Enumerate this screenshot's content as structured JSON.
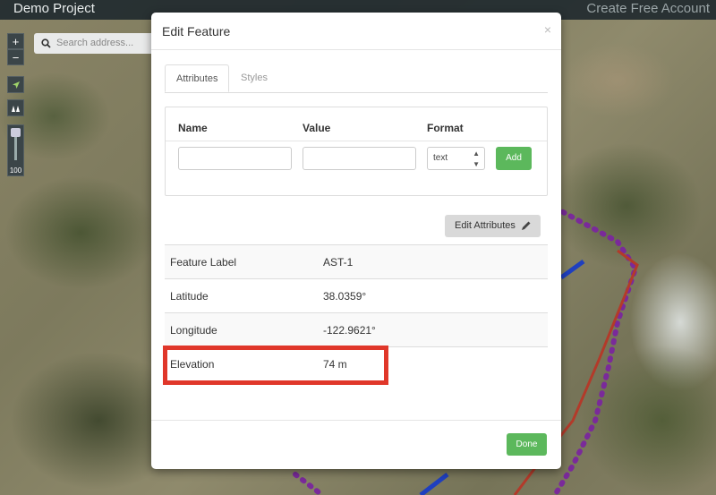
{
  "app": {
    "title": "Demo Project",
    "create_account": "Create Free Account"
  },
  "map_controls": {
    "zoom_in": "+",
    "zoom_out": "−",
    "opacity_value": "100",
    "search_placeholder": "Search address..."
  },
  "modal": {
    "title": "Edit Feature",
    "close": "×",
    "tabs": [
      {
        "label": "Attributes",
        "active": true
      },
      {
        "label": "Styles",
        "active": false
      }
    ],
    "attribute_form": {
      "col_name": "Name",
      "col_value": "Value",
      "col_format": "Format",
      "name_value": "",
      "value_value": "",
      "format_selected": "text",
      "add_label": "Add"
    },
    "edit_attributes_label": "Edit Attributes",
    "properties": [
      {
        "key": "Feature Label",
        "value": "AST-1"
      },
      {
        "key": "Latitude",
        "value": "38.0359°"
      },
      {
        "key": "Longitude",
        "value": "-122.9621°"
      },
      {
        "key": "Elevation",
        "value": "74 m"
      }
    ],
    "done_label": "Done"
  },
  "colors": {
    "accent_green": "#5cb85c",
    "highlight_red": "#e0372a",
    "route_purple": "#7a2a9a",
    "route_red": "#b33a2a",
    "route_blue": "#1f3fbf"
  },
  "icons": [
    "search-icon",
    "locate-arrow-icon",
    "map-layers-icon",
    "pencil-icon",
    "close-icon",
    "select-arrows-icon"
  ]
}
